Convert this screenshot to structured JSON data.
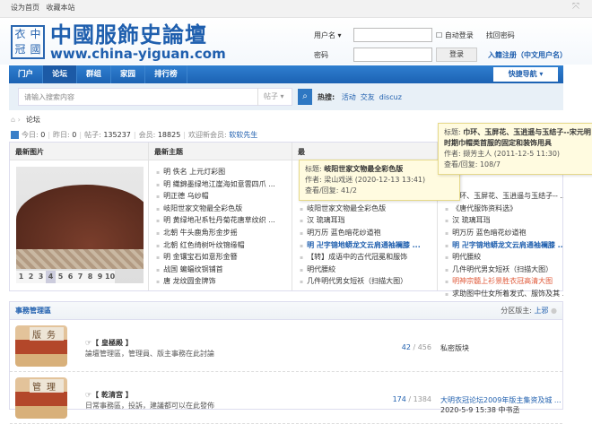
{
  "topbar": {
    "set_home": "设为首页",
    "bookmark": "收藏本站"
  },
  "logo": {
    "seal": [
      "衣",
      "中",
      "冠",
      "國"
    ],
    "title": "中國服飾史論壇",
    "url": "www.china-yiguan.com"
  },
  "login": {
    "username_label": "用户名 ▾",
    "password_label": "密码",
    "auto_login": "自动登录",
    "forgot": "找回密码",
    "login_btn": "登录",
    "register": "入籍注册（中文用户名）"
  },
  "nav": {
    "items": [
      "门户",
      "论坛",
      "群组",
      "家园",
      "排行榜"
    ],
    "quick_nav": "快捷导航 ▾"
  },
  "search": {
    "placeholder": "请输入搜索内容",
    "type": "帖子 ▾",
    "hot_label": "热搜:",
    "hot": [
      "活动",
      "交友",
      "discuz"
    ]
  },
  "breadcrumb": {
    "current": "论坛"
  },
  "stats": {
    "today_label": "今日:",
    "today": "0",
    "yesterday_label": "昨日:",
    "yesterday": "0",
    "posts_label": "帖子:",
    "posts": "135237",
    "members_label": "会员:",
    "members": "18825",
    "welcome_label": "欢迎新会员:",
    "new_member": "软软先生"
  },
  "panels": {
    "images_title": "最新图片",
    "pages": [
      "1",
      "2",
      "3",
      "4",
      "5",
      "6",
      "7",
      "8",
      "9",
      "10"
    ],
    "topics_title": "最新主题",
    "topics": [
      "明 佚名 上元灯彩图",
      "明 織錦墨绿地江崖海如意雲四爪 ...",
      "明正德 乌纱帽",
      "岐阳世家文物最全彩色版",
      "明 黄绿地卍系牡丹菊花唐草纹织 ...",
      "北朝 牛头鹿角形金步摇",
      "北朝 红色绮树叶纹锦缘帽",
      "明 金镶宝石如意形金簪",
      "战国 蝙蝠纹铜铺首",
      "唐 龙纹圆金牌饰"
    ],
    "col3_title": "最",
    "col3": [
      "",
      "",
      "",
      "岐阳世家文物最全彩色版",
      "汉 琉璃耳珰",
      "明万历 蓝色暗花纱道袍",
      "明 卍字锦地蟒龙文云肩通袖襕膝 ...",
      "【转】成语中的古代冠冕和服饰",
      "明代腰絞",
      "几件明代男女短袄（扫描大图）"
    ],
    "col4": [
      "",
      "",
      "巾环、玉屏花、玉逍遥与玉结子-- ...",
      "《唐代服饰资料选》",
      "汉 琉璃耳珰",
      "明万历 蓝色暗花纱道袍",
      "明 卍字锦地蟒龙文云肩通袖襕膝 ...",
      "明代腰絞",
      "几件明代男女短袄（扫描大图）",
      "明神宗髓上衫景胜衣冠高清大图",
      "求助图中仕女所着发式、服饰及其 ..."
    ]
  },
  "tooltip1": {
    "title_label": "标题:",
    "title": "岐阳世家文物最全彩色版",
    "author_label": "作者:",
    "author": "梁山戏迷 (2020-12-13 13:41)",
    "views_label": "查看/回复:",
    "views": "41/2"
  },
  "tooltip2": {
    "title_label": "标题:",
    "title": "巾环、玉屏花、玉逍遥与玉结子--宋元明时期巾帽类首服的固定和装饰用具",
    "author_label": "作者:",
    "author": "撷芳主人 (2011-12-5 11:30)",
    "views_label": "查看/回复:",
    "views": "108/7"
  },
  "section": {
    "title": "事務管理區",
    "moderator_label": "分区版主:",
    "moderator": "上邪",
    "forums": [
      {
        "img_text": "版务",
        "name": "☞【 皇極殿 】",
        "desc": "論壇管理區，管理員、版主事務在此討論",
        "topics": "42",
        "posts": "456",
        "last": "私密版块",
        "last_time": ""
      },
      {
        "img_text": "管理",
        "name": "☞【 乾清宮 】",
        "desc": "日常事務區，投訴，建議都可以在此發佈",
        "topics": "174",
        "posts": "1384",
        "last": "大明衣冠论坛2009年版主集资及城 ...",
        "last_time": "2020-5-9 15:38 中书丞"
      }
    ]
  },
  "colors": {
    "brand": "#1f5fae",
    "nav": "#2a72c4",
    "tooltip": "#fffbe0",
    "hot_red": "#e05a3a"
  }
}
